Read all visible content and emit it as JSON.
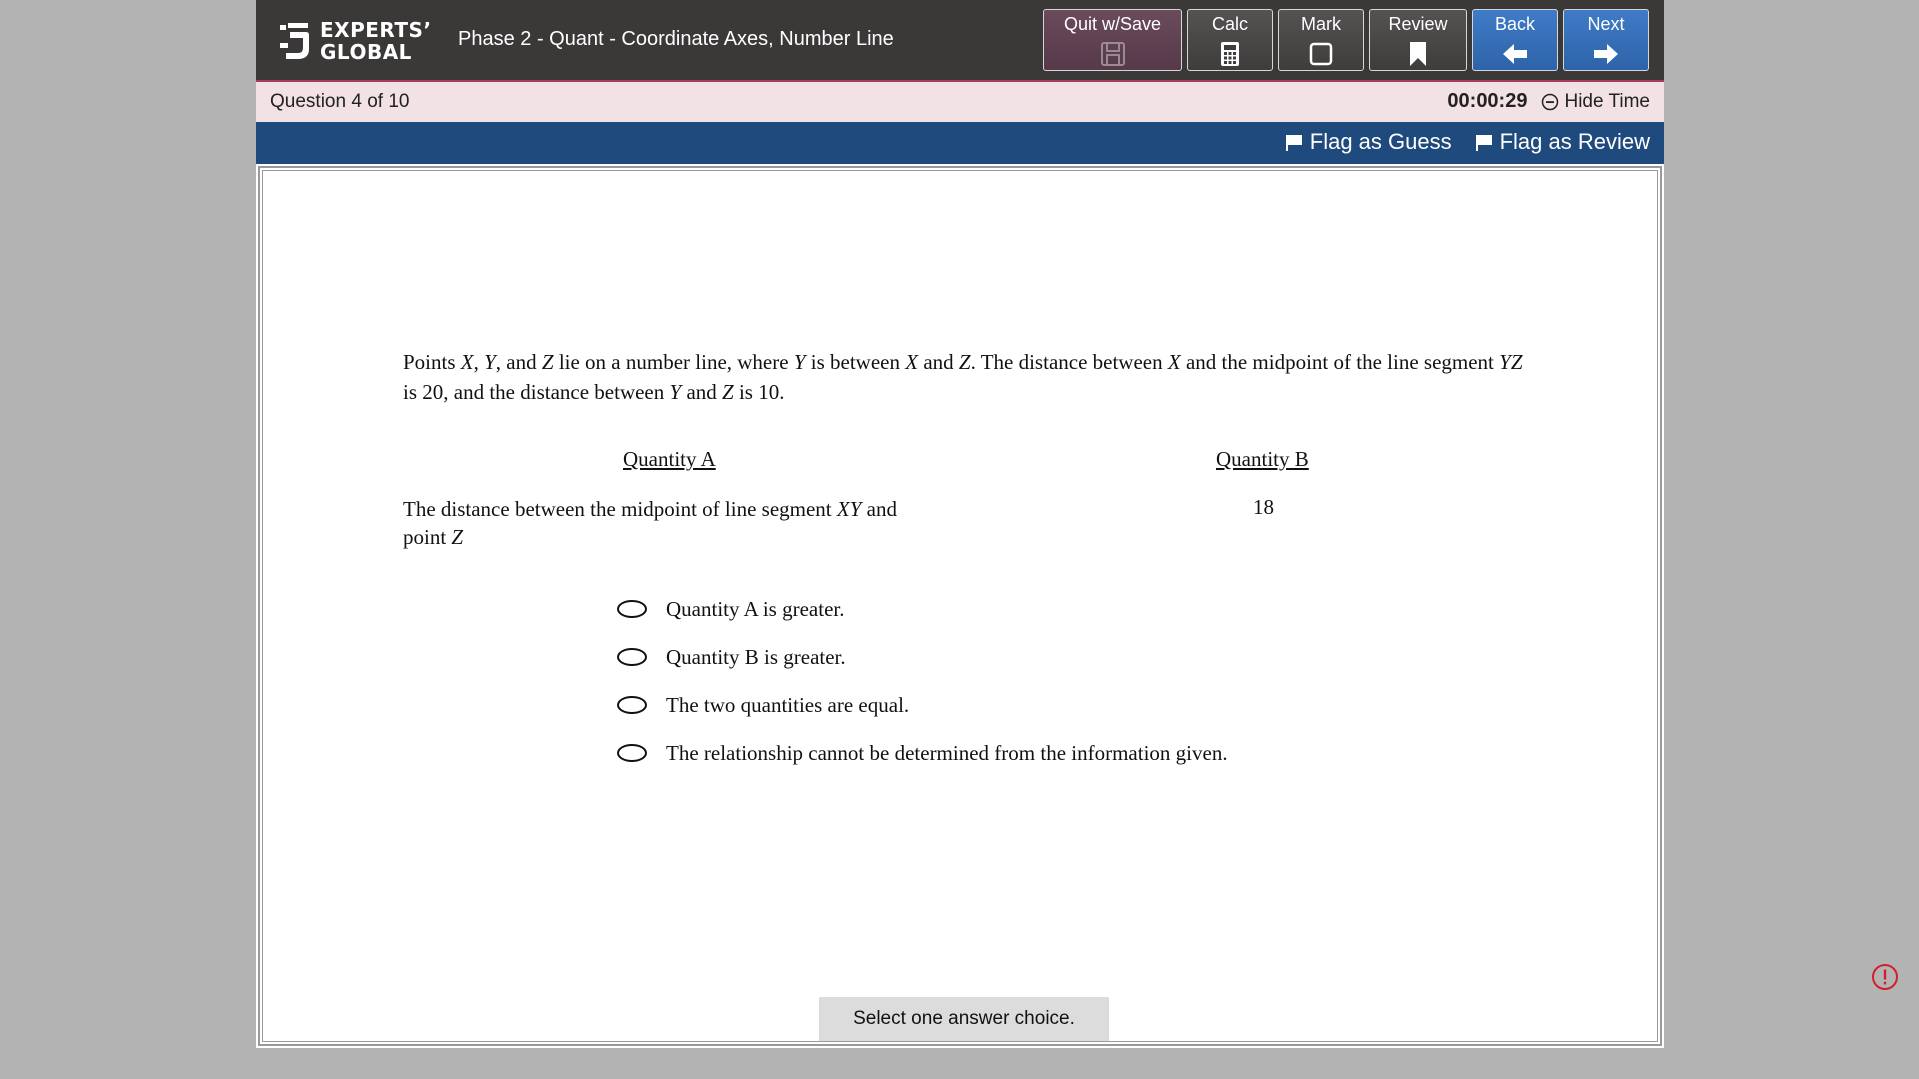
{
  "header": {
    "logo_line1": "EXPERTS’",
    "logo_line2": "GLOBAL",
    "section_title": "Phase 2 - Quant - Coordinate Axes, Number Line",
    "buttons": {
      "quit": "Quit w/Save",
      "calc": "Calc",
      "mark": "Mark",
      "review": "Review",
      "back": "Back",
      "next": "Next"
    },
    "icons": {
      "quit": "save-icon",
      "calc": "calculator-icon",
      "mark": "checkbox-icon",
      "review": "bookmark-icon",
      "back": "arrow-left-icon",
      "next": "arrow-right-icon"
    },
    "colors": {
      "bar": "#3b3838",
      "quit_button": "#6b4b5b",
      "nav_button": "#3f7bc8",
      "accent_line": "#a63d5c"
    }
  },
  "question_bar": {
    "label": "Question",
    "current": "4",
    "of_label": "of",
    "total": "10",
    "timer": "00:00:29",
    "hide_time": "Hide Time"
  },
  "flag_bar": {
    "flag_guess": "Flag as Guess",
    "flag_review": "Flag as Review",
    "color": "#1f4a7d"
  },
  "question": {
    "stem": {
      "points": "Points",
      "X": "X",
      "Y": "Y",
      "Z": "Z",
      "YZ": "YZ",
      "and": "and",
      "comma": ",",
      "lie_on": "lie on a number line, where",
      "is_between": "is between",
      "distance_x_mid": ". The distance between",
      "and_mid": "and the midpoint of the line segment",
      "is_20": "is 20, and the distance between",
      "is_10": "is 10."
    },
    "quantity_a_heading": "Quantity A",
    "quantity_b_heading": "Quantity B",
    "quantity_a": {
      "text1": "The distance between the midpoint of line segment",
      "XY": "XY",
      "text2": "and point",
      "Z": "Z"
    },
    "quantity_b": "18",
    "choices": [
      "Quantity A is greater.",
      "Quantity B is greater.",
      "The two quantities are equal.",
      "The relationship cannot be determined from the information given."
    ],
    "hint": "Select one answer choice."
  }
}
